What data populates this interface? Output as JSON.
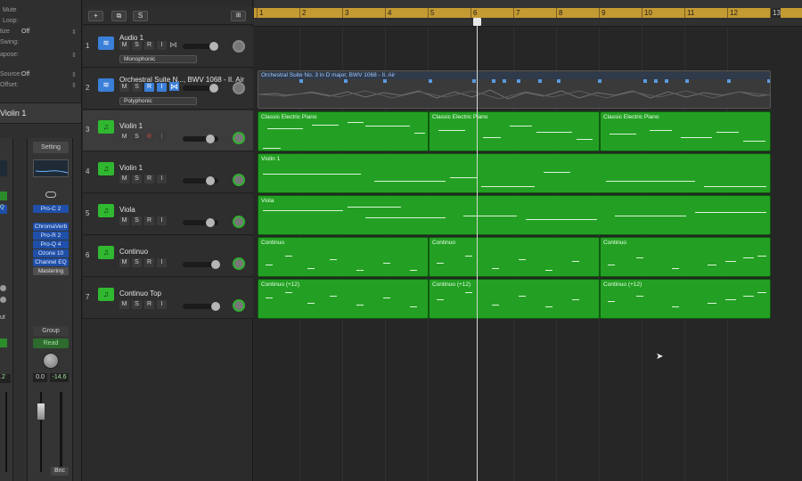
{
  "inspector": {
    "rows": [
      {
        "label": "Mute",
        "value": ""
      },
      {
        "label": "Loop:",
        "value": ""
      },
      {
        "label": "tize",
        "value": "Off"
      },
      {
        "label": "Swing:",
        "value": ""
      },
      {
        "label": "apose:",
        "value": ""
      },
      {
        "label": "Source:",
        "value": "Off"
      },
      {
        "label": "Offset:",
        "value": ""
      }
    ],
    "track_name": "Violin 1",
    "setting_label": "Setting",
    "plugins_top": [
      "Pro-C 2"
    ],
    "plugins": [
      "ChromaVerb",
      "Pro-R 2",
      "Pro-Q 4",
      "Ozone 10",
      "Channel EQ",
      "Mastering"
    ],
    "strip1_labels": [
      "Q",
      "ut"
    ],
    "group_label": "Group",
    "read_label": "Read",
    "vol_value": "0.0",
    "peak_value": "-14.6",
    "left_value": ".2",
    "bnc_label": "Bnc"
  },
  "toolbar": {
    "add": "+",
    "duplicate": "⧉",
    "solo": "S"
  },
  "tracks": [
    {
      "num": "1",
      "name": "Audio 1",
      "type": "audio",
      "mode": "Monophonic",
      "selected": false
    },
    {
      "num": "2",
      "name": "Orchestral Suite N..., BWV 1068 - II. Air",
      "type": "audio",
      "mode": "Polyphonic",
      "selected": false
    },
    {
      "num": "3",
      "name": "Violin 1",
      "type": "midi",
      "mode": "",
      "selected": true
    },
    {
      "num": "4",
      "name": "Violin 1",
      "type": "midi",
      "mode": "",
      "selected": false
    },
    {
      "num": "5",
      "name": "Viola",
      "type": "midi",
      "mode": "",
      "selected": false
    },
    {
      "num": "6",
      "name": "Continuo",
      "type": "midi",
      "mode": "",
      "selected": false
    },
    {
      "num": "7",
      "name": "Continuo Top",
      "type": "midi",
      "mode": "",
      "selected": false
    }
  ],
  "buttons": {
    "m": "M",
    "s": "S",
    "r": "R",
    "i": "I"
  },
  "ruler": {
    "bars": [
      "1",
      "2",
      "3",
      "4",
      "5",
      "6",
      "7",
      "8",
      "9",
      "10",
      "11",
      "12",
      "13"
    ]
  },
  "audio_region_title": "Orchestral Suite No. 3 in D major, BWV 1068 - II. Air",
  "regions": [
    {
      "lane": 3,
      "title": "Classic Electric Piano"
    },
    {
      "lane": 3,
      "title": "Classic Electric Piano"
    },
    {
      "lane": 3,
      "title": "Classic Electric Piano"
    },
    {
      "lane": 4,
      "title": "Violin 1"
    },
    {
      "lane": 5,
      "title": "Viola"
    },
    {
      "lane": 6,
      "title": "Continuo"
    },
    {
      "lane": 6,
      "title": "Continuo"
    },
    {
      "lane": 6,
      "title": "Continuo"
    },
    {
      "lane": 7,
      "title": "Continuo (+12)"
    },
    {
      "lane": 7,
      "title": "Continuo (+12)"
    },
    {
      "lane": 7,
      "title": "Continuo (+12)"
    }
  ],
  "colors": {
    "midi_region": "#23a023",
    "ruler": "#c49a32",
    "audio_icon": "#3a7fd8",
    "plugin": "#1f4fa8"
  }
}
